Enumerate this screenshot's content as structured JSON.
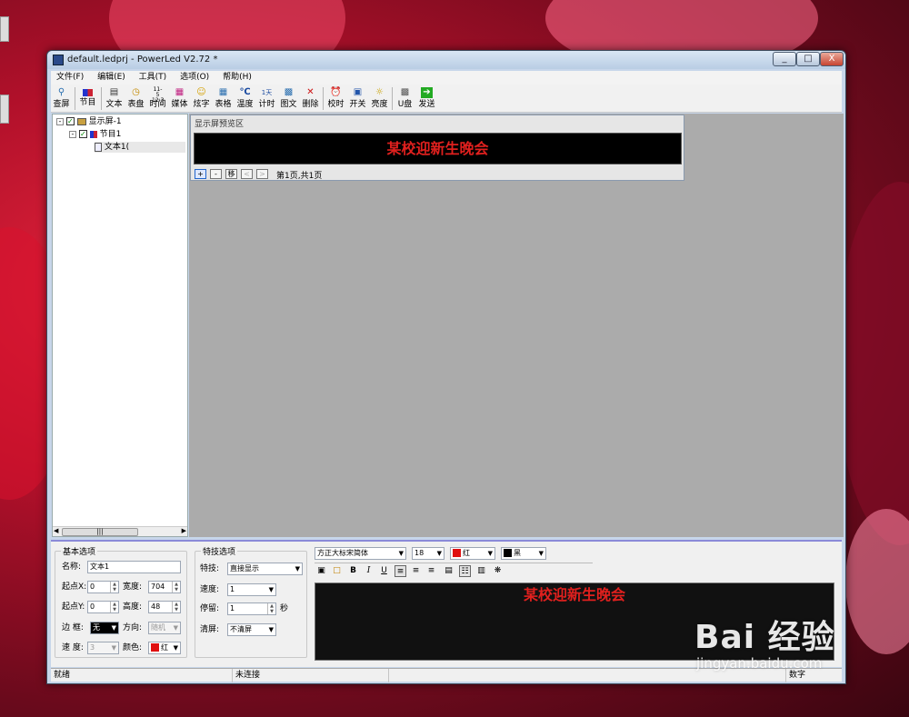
{
  "window": {
    "title": "default.ledprj - PowerLed V2.72 *",
    "controls": [
      "_",
      "□",
      "X"
    ]
  },
  "menu": [
    "文件(F)",
    "编辑(E)",
    "工具(T)",
    "选项(O)",
    "帮助(H)"
  ],
  "toolbar": [
    {
      "label": "查屏",
      "icon": "magnifier-icon"
    },
    {
      "label": "节目",
      "icon": "program-icon"
    },
    {
      "label": "文本",
      "icon": "text-icon"
    },
    {
      "label": "表盘",
      "icon": "clock-icon"
    },
    {
      "label": "时间",
      "icon": "time-icon"
    },
    {
      "label": "媒体",
      "icon": "media-icon"
    },
    {
      "label": "炫字",
      "icon": "smiley-icon"
    },
    {
      "label": "表格",
      "icon": "table-icon"
    },
    {
      "label": "温度",
      "icon": "temperature-icon"
    },
    {
      "label": "计时",
      "icon": "timer-icon"
    },
    {
      "label": "图文",
      "icon": "image-text-icon"
    },
    {
      "label": "删除",
      "icon": "delete-icon"
    },
    {
      "label": "校时",
      "icon": "alarm-clock-icon"
    },
    {
      "label": "开关",
      "icon": "power-icon"
    },
    {
      "label": "亮度",
      "icon": "bulb-icon"
    },
    {
      "label": "U盘",
      "icon": "usb-icon"
    },
    {
      "label": "发送",
      "icon": "send-arrow-icon"
    }
  ],
  "tree": {
    "screen": "显示屏-1",
    "program": "节目1",
    "text": "文本1("
  },
  "preview": {
    "title": "显示屏预览区",
    "led_text": "某校迎新生晚会",
    "buttons": [
      "+",
      "-",
      "移",
      "<",
      ">"
    ],
    "page_info": "第1页,共1页"
  },
  "basic": {
    "legend": "基本选项",
    "name_label": "名称:",
    "name_value": "文本1",
    "x_label": "起点X:",
    "x_value": "0",
    "width_label": "宽度:",
    "width_value": "704",
    "y_label": "起点Y:",
    "y_value": "0",
    "height_label": "高度:",
    "height_value": "48",
    "border_label": "边  框:",
    "border_value": "无",
    "direction_label": "方向:",
    "direction_value": "随机",
    "speed_label": "速  度:",
    "speed_value": "3",
    "color_label": "颜色:",
    "color_value": "红"
  },
  "effects": {
    "legend": "特技选项",
    "effect_label": "特技:",
    "effect_value": "直接显示",
    "speed_label": "速度:",
    "speed_value": "1",
    "stay_label": "停留:",
    "stay_value": "1",
    "stay_unit": "秒",
    "clear_label": "清屏:",
    "clear_value": "不清屏"
  },
  "format": {
    "font": "方正大标宋简体",
    "size": "18",
    "fg_color": "红",
    "bg_color": "黑",
    "fg_hex": "#e01010",
    "bg_hex": "#000000",
    "bold": "B",
    "italic": "I",
    "underline": "U"
  },
  "editor": {
    "text": "某校迎新生晚会"
  },
  "status": {
    "ready": "就绪",
    "connection": "未连接",
    "mode": "数字"
  },
  "watermark": {
    "logo": "Bai 经验",
    "url": "jingyan.baidu.com"
  }
}
